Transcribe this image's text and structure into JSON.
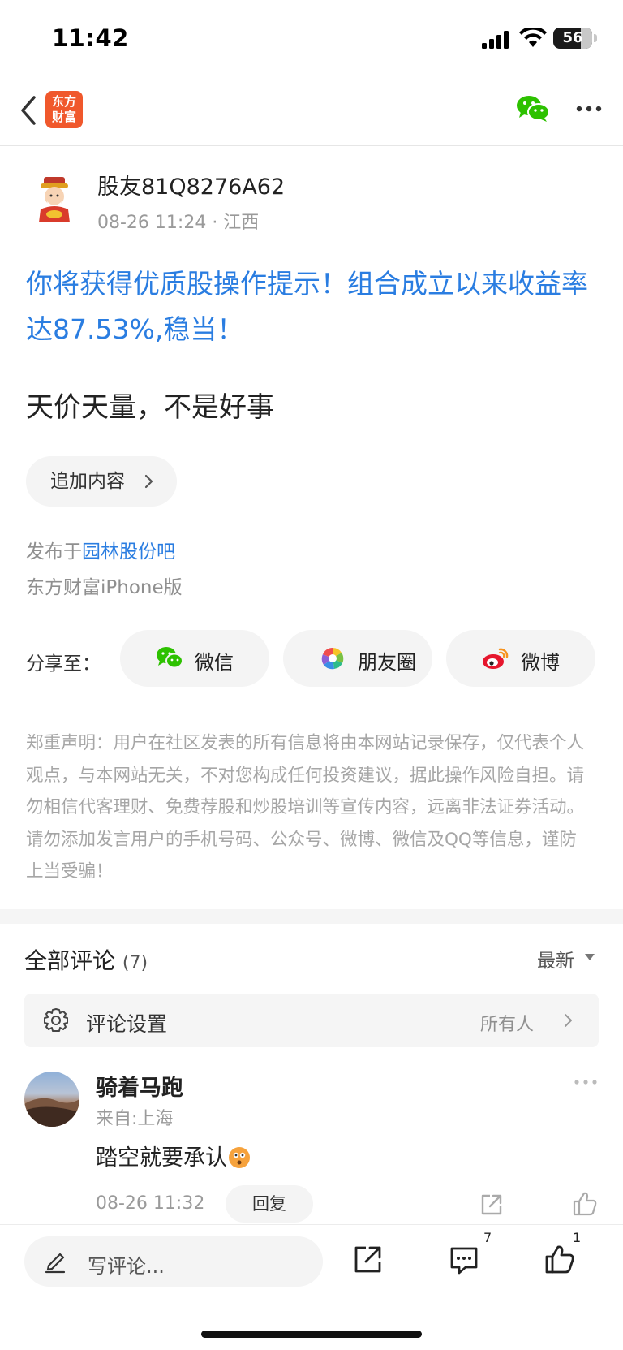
{
  "status_bar": {
    "time": "11:42",
    "battery": "56"
  },
  "nav": {
    "logo_line1": "东方",
    "logo_line2": "财富"
  },
  "post": {
    "author": "股友81Q8276A62",
    "meta": "08-26 11:24 · 江西",
    "title": "你将获得优质股操作提示！组合成立以来收益率达87.53%,稳当！",
    "body": "天价天量，不是好事",
    "append_label": "追加内容",
    "published_prefix": "发布于",
    "forum": "园林股份吧",
    "client": "东方财富iPhone版"
  },
  "share": {
    "label": "分享至：",
    "wechat": "微信",
    "moments": "朋友圈",
    "weibo": "微博"
  },
  "disclaimer": "郑重声明：用户在社区发表的所有信息将由本网站记录保存，仅代表个人观点，与本网站无关，不对您构成任何投资建议，据此操作风险自担。请勿相信代客理财、免费荐股和炒股培训等宣传内容，远离非法证券活动。请勿添加发言用户的手机号码、公众号、微博、微信及QQ等信息，谨防上当受骗！",
  "comments": {
    "title": "全部评论",
    "count": "(7)",
    "sort": "最新",
    "settings_label": "评论设置",
    "settings_value": "所有人",
    "items": [
      {
        "name": "骑着马跑",
        "location": "来自:上海",
        "text": "踏空就要承认",
        "time": "08-26 11:32",
        "reply_label": "回复"
      }
    ]
  },
  "bottom_bar": {
    "placeholder": "写评论...",
    "comment_count": "7",
    "like_count": "1"
  },
  "colors": {
    "link": "#2a7de1",
    "brand": "#f0582c",
    "wechat": "#2dc100"
  }
}
